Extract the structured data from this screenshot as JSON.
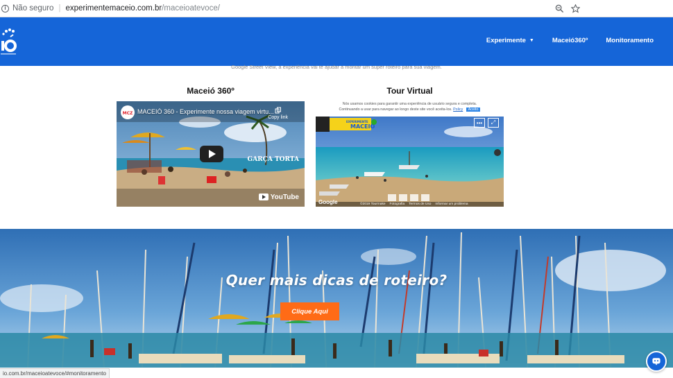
{
  "browser": {
    "security_label": "Não seguro",
    "url_host": "experimentemaceio.com.br",
    "url_path": "/maceioatevoce/",
    "status_url": "io.com.br/maceioatevoce/#monitoramento"
  },
  "nav": {
    "items": [
      {
        "label": "Experimente",
        "has_dropdown": true
      },
      {
        "label": "Maceió360º"
      },
      {
        "label": "Monitoramento"
      }
    ]
  },
  "intro_text": "Google Street View, a experiência vai te ajudar a montar um super roteiro para sua viagem.",
  "sections": {
    "maceio360": {
      "title": "Maceió 360º",
      "video_title": "MACEIÓ 360 - Experimente nossa viagem virtu...",
      "copy_link": "Copy link",
      "watermark": "GARÇA TORTA",
      "youtube_label": "YouTube"
    },
    "tour": {
      "title": "Tour Virtual",
      "cookie_text_1": "Nós usamos cookies para garantir uma experiência de usuário segura e completa.",
      "cookie_text_2": "Continuando a usar para navegar ao longo deste site você aceita-los.",
      "policy_label": "Policy",
      "accept_label": "Aceito",
      "brand_text": "EXPERIMENTE",
      "brand_city": "MACEIÓ",
      "google_label": "Google",
      "footer_items": [
        "©2019 Tourmake",
        "Fotografia",
        "Termos de Uso",
        "Informar um problema"
      ]
    }
  },
  "banner": {
    "title": "Quer mais dicas de roteiro?",
    "cta_label": "Clique Aqui"
  },
  "colors": {
    "header_blue": "#1565d8",
    "cta_orange": "#ff6b16"
  }
}
